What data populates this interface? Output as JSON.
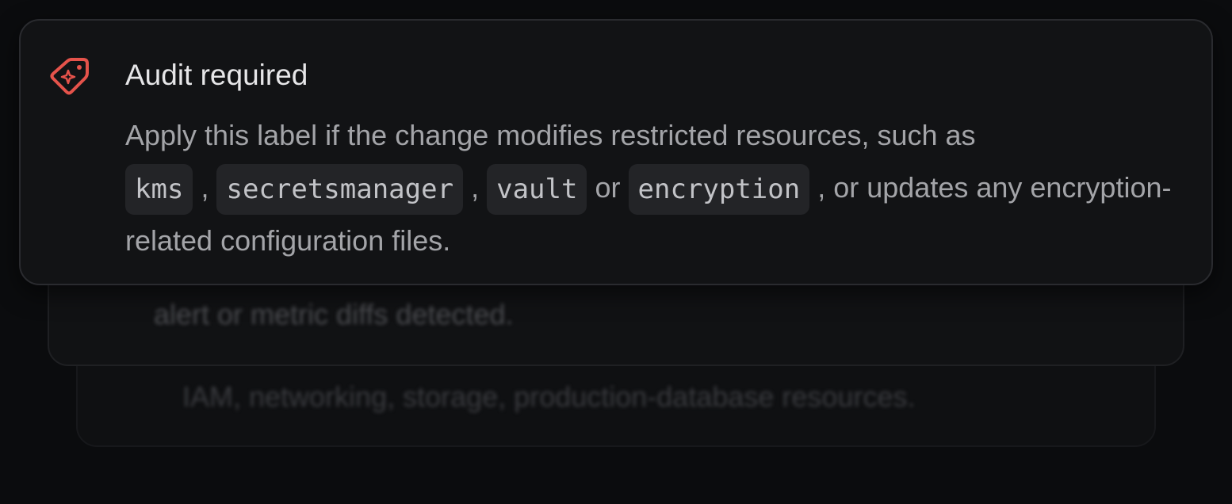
{
  "accent_color": "#e5534b",
  "cards": {
    "back": {
      "text": "IAM, networking, storage, production-database resources."
    },
    "middle": {
      "text": "alert or metric diffs detected."
    },
    "front": {
      "icon": "tag-icon",
      "title": "Audit required",
      "description": {
        "intro": "Apply this label if the change modifies restricted resources, such as",
        "codes": [
          "kms",
          "secretsmanager",
          "vault",
          "encryption"
        ],
        "sep1": ",",
        "sep2": ",",
        "sep3": "or",
        "tail": ", or updates any encryption-related configuration files."
      }
    }
  }
}
